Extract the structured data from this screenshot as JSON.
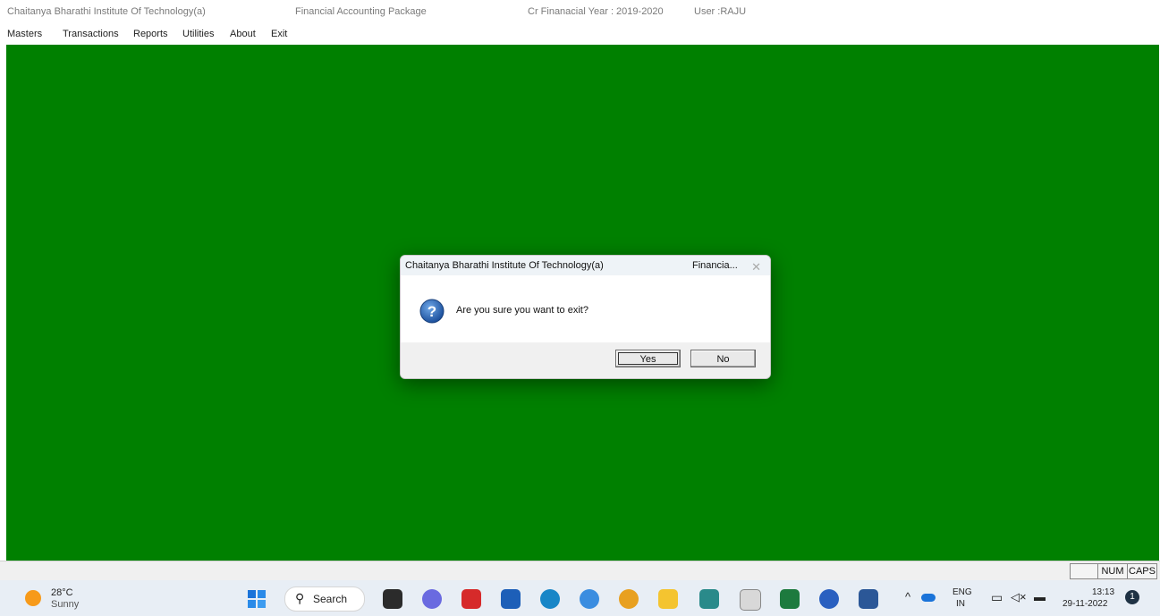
{
  "app": {
    "institute": "Chaitanya Bharathi Institute Of Technology(a)",
    "package": "Financial Accounting Package",
    "fin_year": "Cr Finanacial Year : 2019-2020",
    "user": "User  :RAJU"
  },
  "menu": [
    "Masters",
    "Transactions",
    "Reports",
    "Utilities",
    "About",
    "Exit"
  ],
  "status": {
    "num": "NUM",
    "caps": "CAPS"
  },
  "dialog": {
    "title": "Chaitanya Bharathi Institute Of Technology(a)",
    "title_right": "Financia...",
    "message": "Are you sure you want to exit?",
    "yes": "Yes",
    "no": "No",
    "icon": "question-icon"
  },
  "taskbar": {
    "temp": "28°C",
    "condition": "Sunny",
    "search": "Search",
    "lang": "ENG",
    "region": "IN",
    "time": "13:13",
    "date": "29-11-2022",
    "notifications": "1"
  },
  "colors": {
    "desktop": "#008000",
    "dialog_title": "#eef3f7"
  }
}
